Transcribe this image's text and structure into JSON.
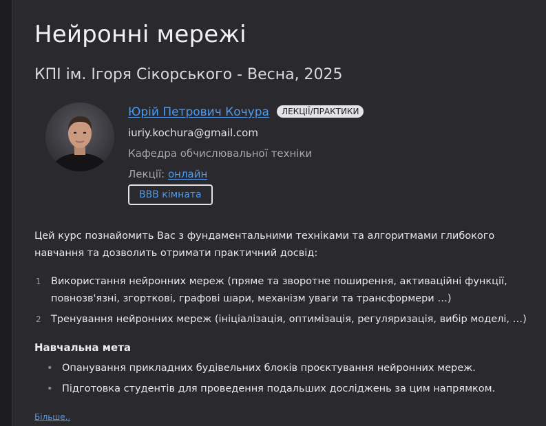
{
  "course": {
    "title": "Нейронні мережі",
    "subtitle": "КПІ ім. Ігоря Сікорського - Весна, 2025"
  },
  "instructor": {
    "name": "Юрій Петрович Кочура",
    "role": "ЛЕКЦІЇ/ПРАКТИКИ",
    "email": "iuriy.kochura@gmail.com",
    "department": "Кафедра обчислювальної техніки",
    "lectures_label": "Лекції:",
    "lectures_link": "онлайн",
    "room_button": "BBB кімната"
  },
  "description": {
    "intro": "Цей курс познайомить Вас з фундаментальними техніками та алгоритмами глибокого навчання та дозволить отримати практичний досвід:",
    "topics": [
      {
        "num": "1",
        "text": "Використання нейронних мереж (пряме та зворотне поширення, активаційні функції, повнозв'язні, згорткові, графові шари, механізм уваги та трансформери …)"
      },
      {
        "num": "2",
        "text": "Тренування нейронних мереж (ініціалізація, оптимізація, регуляризація, вибір моделі, …)"
      }
    ]
  },
  "goal": {
    "title": "Навчальна мета",
    "items": [
      "Опанування прикладних будівельних блоків проєктування нейронних мереж.",
      "Підготовка студентів для проведення подальших досліджень за цим напрямком."
    ],
    "bullet": "•"
  },
  "more_link": "Більше..",
  "colors": {
    "background": "#1d1c21",
    "panel": "#2a292e",
    "link": "#4d9bf0",
    "badge": "#e4e4e8"
  }
}
